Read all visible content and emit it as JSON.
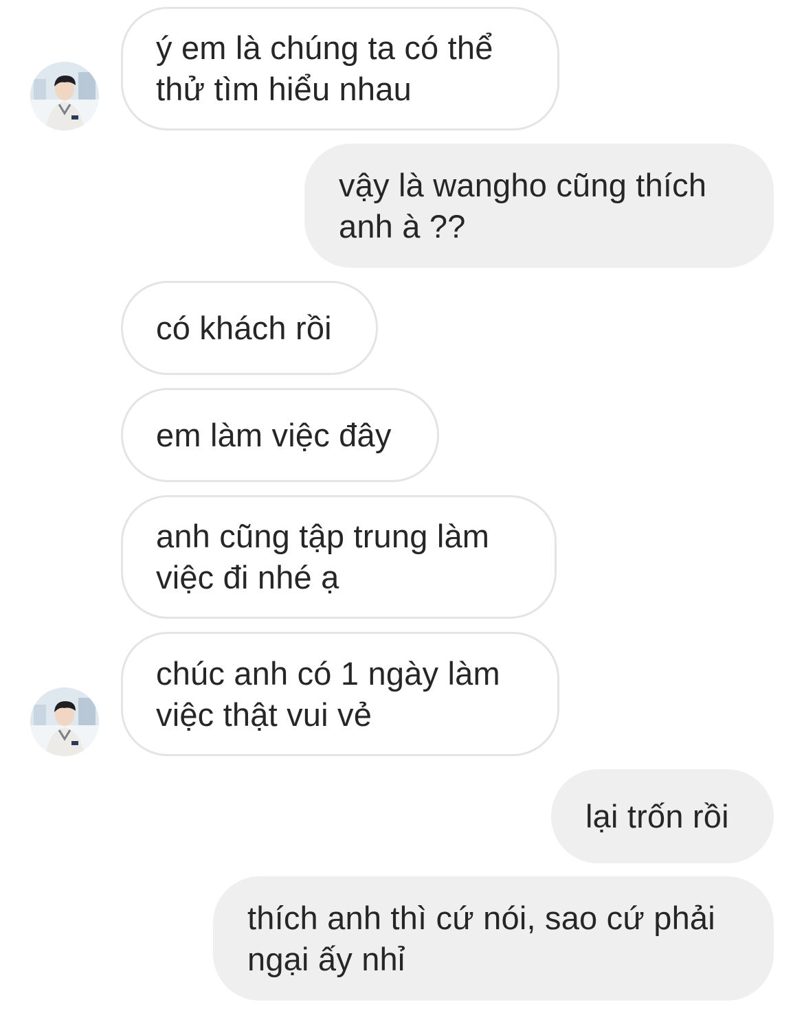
{
  "conversation": {
    "messages": [
      {
        "sender": "other",
        "text": "ý em là chúng ta có thể\nthử tìm hiểu nhau"
      },
      {
        "sender": "me",
        "text": "vậy là wangho cũng thích\nanh à ??"
      },
      {
        "sender": "other",
        "text": "có khách rồi"
      },
      {
        "sender": "other",
        "text": "em làm việc đây"
      },
      {
        "sender": "other",
        "text": "anh cũng tập trung làm\nviệc đi nhé ạ"
      },
      {
        "sender": "other",
        "text": "chúc anh có 1 ngày làm\nviệc thật vui vẻ"
      },
      {
        "sender": "me",
        "text": "lại trốn rồi"
      },
      {
        "sender": "me",
        "text": "thích anh thì cứ nói, sao cứ phải\nngại ấy nhỉ"
      }
    ]
  },
  "colors": {
    "incoming_bubble_border": "#e4e4e4",
    "outgoing_bubble_bg": "#efefef",
    "text": "#262626"
  },
  "icons": {
    "avatar": "contact-avatar-photo"
  }
}
